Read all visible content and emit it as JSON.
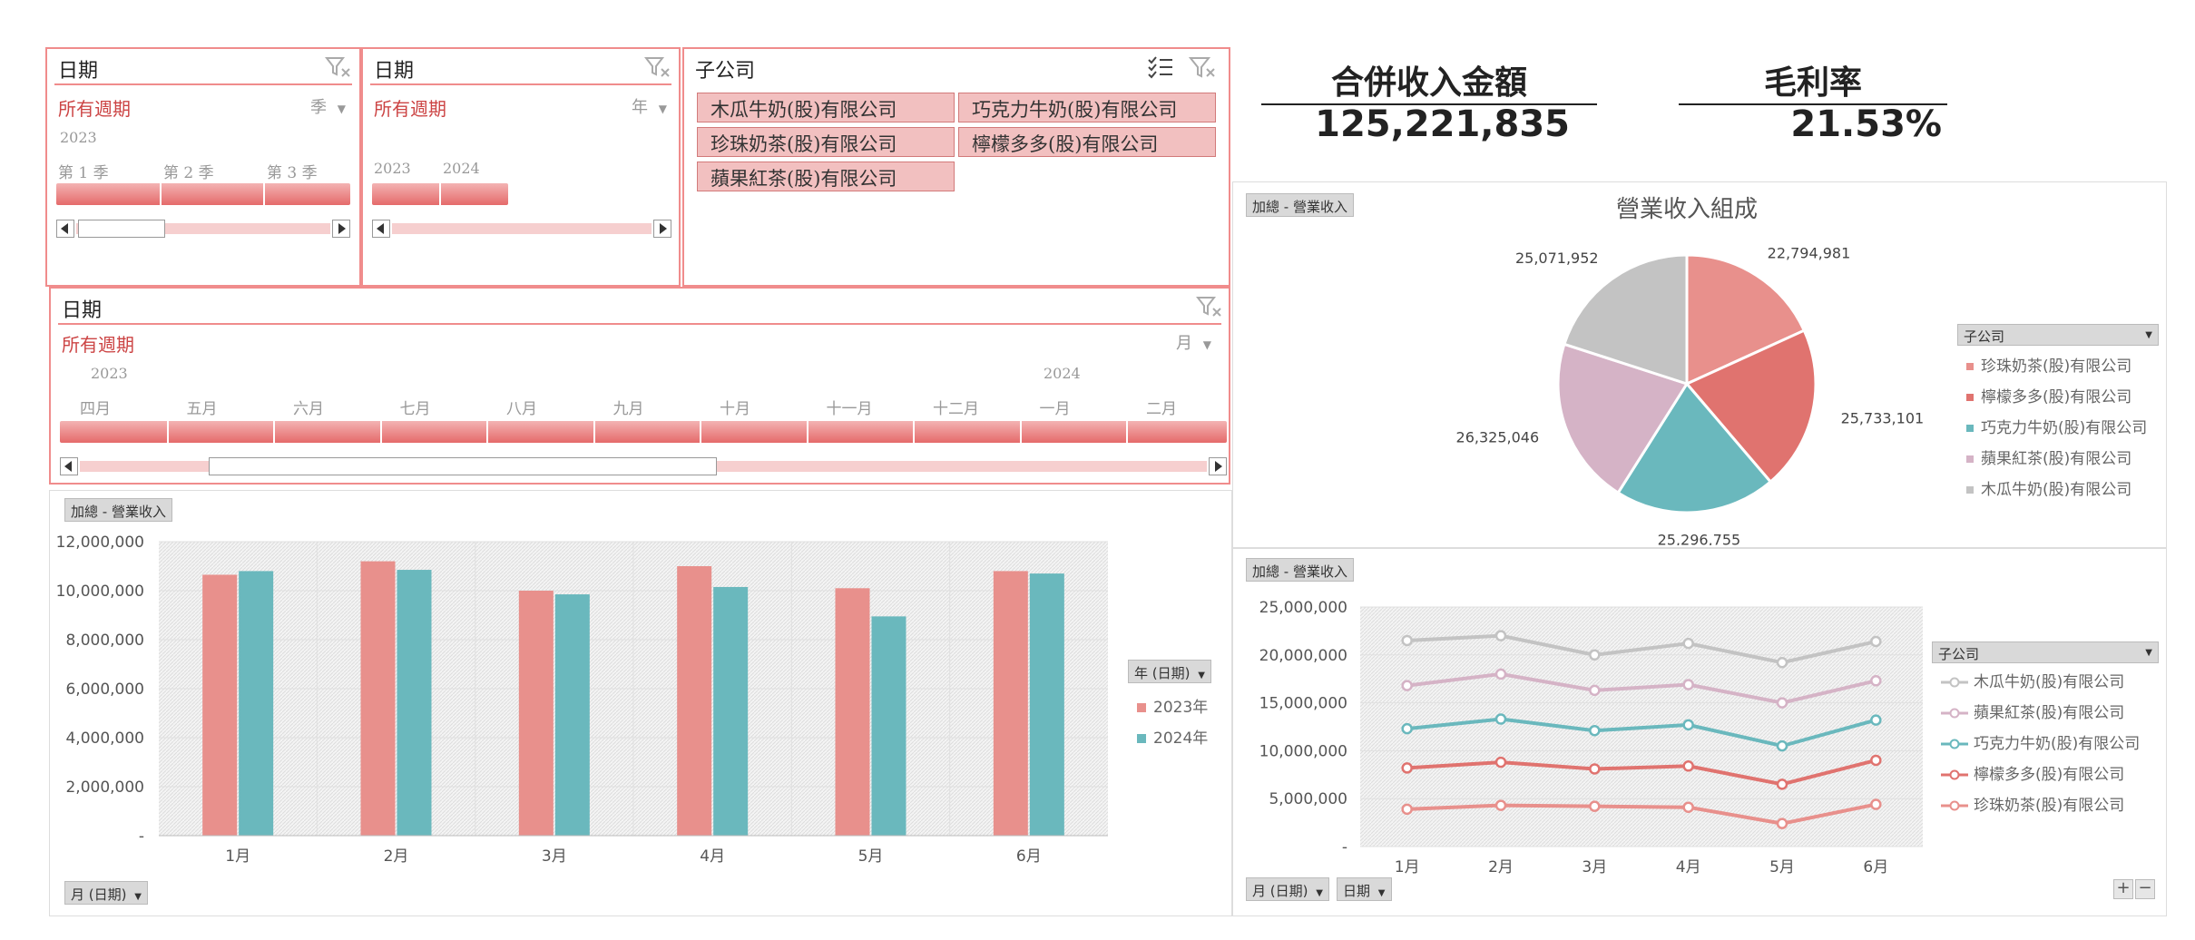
{
  "colors": {
    "accent": "#f08c8c",
    "pink": "#e8908c",
    "red": "#e0736f",
    "teal": "#6ab8bd",
    "mauve": "#d5b3c6",
    "gray": "#c3c3c3"
  },
  "slicer_quarter": {
    "title": "日期",
    "period": "所有週期",
    "level": "季",
    "year": "2023",
    "ticks": [
      "第 1 季",
      "第 2 季",
      "第 3 季"
    ]
  },
  "slicer_year": {
    "title": "日期",
    "period": "所有週期",
    "level": "年",
    "ticks": [
      "2023",
      "2024"
    ]
  },
  "slicer_company": {
    "title": "子公司",
    "items": [
      "木瓜牛奶(股)有限公司",
      "巧克力牛奶(股)有限公司",
      "珍珠奶茶(股)有限公司",
      "檸檬多多(股)有限公司",
      "蘋果紅茶(股)有限公司"
    ]
  },
  "slicer_month": {
    "title": "日期",
    "period": "所有週期",
    "level": "月",
    "year_start": "2023",
    "year_next": "2024",
    "ticks": [
      "四月",
      "五月",
      "六月",
      "七月",
      "八月",
      "九月",
      "十月",
      "十一月",
      "十二月",
      "一月",
      "二月"
    ]
  },
  "kpi": {
    "revenue_title": "合併收入金額",
    "revenue_value": "125,221,835",
    "margin_title": "毛利率",
    "margin_value": "21.53%"
  },
  "bar_panel": {
    "value_field": "加總 - 營業收入",
    "axis_field": "月 (日期)",
    "legend_field": "年 (日期)"
  },
  "pie_panel": {
    "value_field": "加總 - 營業收入",
    "legend_field": "子公司"
  },
  "line_panel": {
    "value_field": "加總 - 營業收入",
    "axis_field_1": "月 (日期)",
    "axis_field_2": "日期",
    "legend_field": "子公司",
    "zoom_in": "+",
    "zoom_out": "−"
  },
  "chart_data": [
    {
      "type": "bar",
      "categories": [
        "1月",
        "2月",
        "3月",
        "4月",
        "5月",
        "6月"
      ],
      "series": [
        {
          "name": "2023年",
          "color": "#e8908c",
          "values": [
            10650000,
            11200000,
            10000000,
            11000000,
            10100000,
            10800000
          ]
        },
        {
          "name": "2024年",
          "color": "#6ab8bd",
          "values": [
            10800000,
            10850000,
            9850000,
            10150000,
            8950000,
            10700000
          ]
        }
      ],
      "ylim": [
        0,
        12000000
      ],
      "yticks": [
        "12,000,000",
        "10,000,000",
        "8,000,000",
        "6,000,000",
        "4,000,000",
        "2,000,000",
        "-"
      ],
      "grid": true,
      "legend": "right"
    },
    {
      "type": "pie",
      "title": "營業收入組成",
      "slices": [
        {
          "name": "珍珠奶茶(股)有限公司",
          "label": "22,794,981",
          "value": 22794981,
          "color": "#e8908c"
        },
        {
          "name": "檸檬多多(股)有限公司",
          "label": "25,733,101",
          "value": 25733101,
          "color": "#e0736f"
        },
        {
          "name": "巧克力牛奶(股)有限公司",
          "label": "25,296,755",
          "value": 25296755,
          "color": "#6ab8bd"
        },
        {
          "name": "蘋果紅茶(股)有限公司",
          "label": "26,325,046",
          "value": 26325046,
          "color": "#d5b3c6"
        },
        {
          "name": "木瓜牛奶(股)有限公司",
          "label": "25,071,952",
          "value": 25071952,
          "color": "#c3c3c3"
        }
      ],
      "legend": "right"
    },
    {
      "type": "line",
      "categories": [
        "1月",
        "2月",
        "3月",
        "4月",
        "5月",
        "6月"
      ],
      "series": [
        {
          "name": "木瓜牛奶(股)有限公司",
          "color": "#c3c3c3",
          "values": [
            21500000,
            22000000,
            20000000,
            21200000,
            19200000,
            21400000
          ]
        },
        {
          "name": "蘋果紅茶(股)有限公司",
          "color": "#d5b3c6",
          "values": [
            16800000,
            18000000,
            16300000,
            16900000,
            15000000,
            17300000
          ]
        },
        {
          "name": "巧克力牛奶(股)有限公司",
          "color": "#6ab8bd",
          "values": [
            12300000,
            13300000,
            12100000,
            12700000,
            10500000,
            13200000
          ]
        },
        {
          "name": "檸檬多多(股)有限公司",
          "color": "#e0736f",
          "values": [
            8200000,
            8800000,
            8100000,
            8400000,
            6500000,
            9000000
          ]
        },
        {
          "name": "珍珠奶茶(股)有限公司",
          "color": "#e8908c",
          "values": [
            3900000,
            4300000,
            4200000,
            4100000,
            2400000,
            4400000
          ]
        }
      ],
      "ylim": [
        0,
        25000000
      ],
      "yticks": [
        "25,000,000",
        "20,000,000",
        "15,000,000",
        "10,000,000",
        "5,000,000",
        "-"
      ],
      "grid": true,
      "legend": "right"
    }
  ]
}
